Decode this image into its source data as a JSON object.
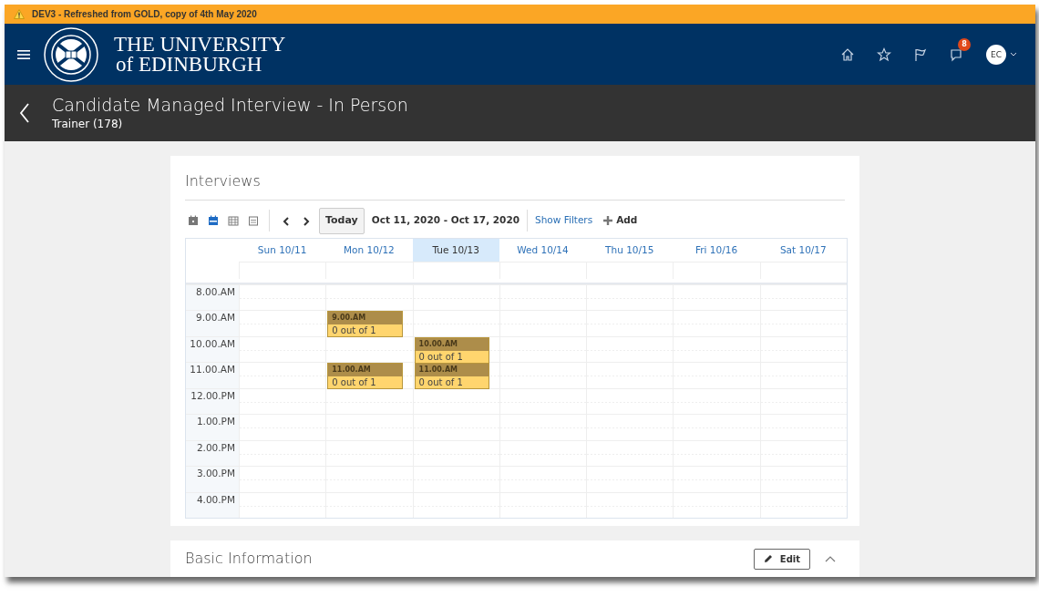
{
  "environment_banner": {
    "text": "DEV3 - Refreshed from GOLD, copy of 4th May 2020"
  },
  "header": {
    "logo": {
      "line_1": "THE UNIVERSITY",
      "line_2": "of EDINBURGH"
    },
    "notification_count": "8",
    "avatar_initials": "EC"
  },
  "page_title": {
    "title": "Candidate Managed Interview - In Person",
    "subtitle": "Trainer (178)"
  },
  "interviews": {
    "title": "Interviews",
    "views": [
      {
        "kind": "day",
        "selected": false
      },
      {
        "kind": "week",
        "selected": true
      },
      {
        "kind": "month",
        "selected": false
      },
      {
        "kind": "list",
        "selected": false
      }
    ],
    "today_button": "Today",
    "date_range": "Oct 11, 2020 - Oct 17, 2020",
    "show_filters": "Show Filters",
    "add": "Add",
    "days": [
      {
        "label": "Sun 10/11",
        "selected": false
      },
      {
        "label": "Mon 10/12",
        "selected": false
      },
      {
        "label": "Tue 10/13",
        "selected": true
      },
      {
        "label": "Wed 10/14",
        "selected": false
      },
      {
        "label": "Thu 10/15",
        "selected": false
      },
      {
        "label": "Fri 10/16",
        "selected": false
      },
      {
        "label": "Sat 10/17",
        "selected": false
      }
    ],
    "time_rows": [
      {
        "label": "8.00.AM"
      },
      {
        "label": "9.00.AM",
        "slots": [
          {
            "kind": "empty"
          },
          {
            "kind": "interview",
            "time": "9.00.AM",
            "text": "0 out of 1"
          },
          {
            "kind": "empty"
          },
          {
            "kind": "empty"
          },
          {
            "kind": "empty"
          },
          {
            "kind": "empty"
          },
          {
            "kind": "empty"
          }
        ]
      },
      {
        "label": "10.00.AM",
        "slots": [
          {
            "kind": "empty"
          },
          {
            "kind": "empty"
          },
          {
            "kind": "interview",
            "time": "10.00.AM",
            "text": "0 out of 1"
          },
          {
            "kind": "empty"
          },
          {
            "kind": "empty"
          },
          {
            "kind": "empty"
          },
          {
            "kind": "empty"
          }
        ]
      },
      {
        "label": "11.00.AM",
        "slots": [
          {
            "kind": "empty"
          },
          {
            "kind": "interview",
            "time": "11.00.AM",
            "text": "0 out of 1"
          },
          {
            "kind": "interview",
            "time": "11.00.AM",
            "text": "0 out of 1"
          },
          {
            "kind": "empty"
          },
          {
            "kind": "empty"
          },
          {
            "kind": "empty"
          },
          {
            "kind": "empty"
          }
        ]
      },
      {
        "label": "12.00.PM"
      },
      {
        "label": "1.00.PM"
      },
      {
        "label": "2.00.PM"
      },
      {
        "label": "3.00.PM"
      },
      {
        "label": "4.00.PM"
      }
    ]
  },
  "basic_information": {
    "title": "Basic Information",
    "edit_button": "Edit",
    "expanded": true
  }
}
